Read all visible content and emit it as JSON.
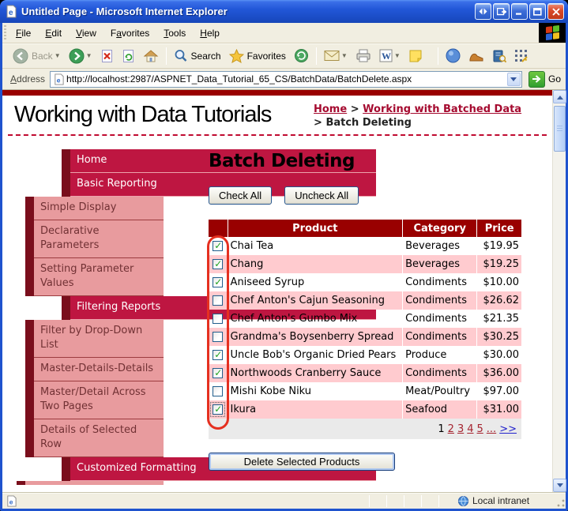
{
  "window": {
    "title": "Untitled Page - Microsoft Internet Explorer",
    "menu": [
      {
        "label": "File",
        "mnemonic": "F"
      },
      {
        "label": "Edit",
        "mnemonic": "E"
      },
      {
        "label": "View",
        "mnemonic": "V"
      },
      {
        "label": "Favorites",
        "mnemonic": "a"
      },
      {
        "label": "Tools",
        "mnemonic": "T"
      },
      {
        "label": "Help",
        "mnemonic": "H"
      }
    ],
    "toolbar": {
      "back_label": "Back",
      "search_label": "Search",
      "favorites_label": "Favorites"
    },
    "address": {
      "label": "Address",
      "url": "http://localhost:2987/ASPNET_Data_Tutorial_65_CS/BatchData/BatchDelete.aspx",
      "go_label": "Go"
    },
    "status": {
      "zone": "Local intranet"
    }
  },
  "page": {
    "site_title": "Working with Data Tutorials",
    "breadcrumb": {
      "home": "Home",
      "sep": ">",
      "section": "Working with Batched Data",
      "current": "Batch Deleting"
    },
    "sidebar": {
      "items": [
        {
          "label": "Home",
          "type": "main"
        },
        {
          "label": "Basic Reporting",
          "type": "main"
        },
        {
          "label": "Simple Display",
          "type": "sub"
        },
        {
          "label": "Declarative Parameters",
          "type": "sub"
        },
        {
          "label": "Setting Parameter Values",
          "type": "sub"
        },
        {
          "label": "Filtering Reports",
          "type": "main"
        },
        {
          "label": "Filter by Drop-Down List",
          "type": "sub"
        },
        {
          "label": "Master-Details-Details",
          "type": "sub"
        },
        {
          "label": "Master/Detail Across Two Pages",
          "type": "sub"
        },
        {
          "label": "Details of Selected Row",
          "type": "sub"
        },
        {
          "label": "Customized Formatting",
          "type": "main"
        }
      ]
    },
    "heading": "Batch Deleting",
    "buttons": {
      "check_all": "Check All",
      "uncheck_all": "Uncheck All",
      "delete": "Delete Selected Products"
    },
    "table": {
      "headers": {
        "product": "Product",
        "category": "Category",
        "price": "Price"
      },
      "rows": [
        {
          "checked": true,
          "focused": false,
          "product": "Chai Tea",
          "category": "Beverages",
          "price": "$19.95"
        },
        {
          "checked": true,
          "focused": false,
          "product": "Chang",
          "category": "Beverages",
          "price": "$19.25"
        },
        {
          "checked": true,
          "focused": false,
          "product": "Aniseed Syrup",
          "category": "Condiments",
          "price": "$10.00"
        },
        {
          "checked": false,
          "focused": false,
          "product": "Chef Anton's Cajun Seasoning",
          "category": "Condiments",
          "price": "$26.62"
        },
        {
          "checked": false,
          "focused": false,
          "product": "Chef Anton's Gumbo Mix",
          "category": "Condiments",
          "price": "$21.35"
        },
        {
          "checked": false,
          "focused": false,
          "product": "Grandma's Boysenberry Spread",
          "category": "Condiments",
          "price": "$30.25"
        },
        {
          "checked": true,
          "focused": false,
          "product": "Uncle Bob's Organic Dried Pears",
          "category": "Produce",
          "price": "$30.00"
        },
        {
          "checked": true,
          "focused": false,
          "product": "Northwoods Cranberry Sauce",
          "category": "Condiments",
          "price": "$36.00"
        },
        {
          "checked": false,
          "focused": false,
          "product": "Mishi Kobe Niku",
          "category": "Meat/Poultry",
          "price": "$97.00"
        },
        {
          "checked": true,
          "focused": true,
          "product": "Ikura",
          "category": "Seafood",
          "price": "$31.00"
        }
      ],
      "pager": {
        "current": "1",
        "links": [
          "2",
          "3",
          "4",
          "5"
        ],
        "ellipsis": "...",
        "next": ">>"
      }
    }
  },
  "colors": {
    "header_red": "#990000",
    "sidebar_crimson": "#BE1641",
    "sidebar_maroon": "#7A0E1C",
    "sidebar_pink": "#E89B9E",
    "row_alt_pink": "#FFCBCF",
    "link_red": "#A50A2F",
    "pager_next_blue": "#2222CC",
    "annotation_red": "#E53020",
    "titlebar_blue": "#2257D8"
  }
}
